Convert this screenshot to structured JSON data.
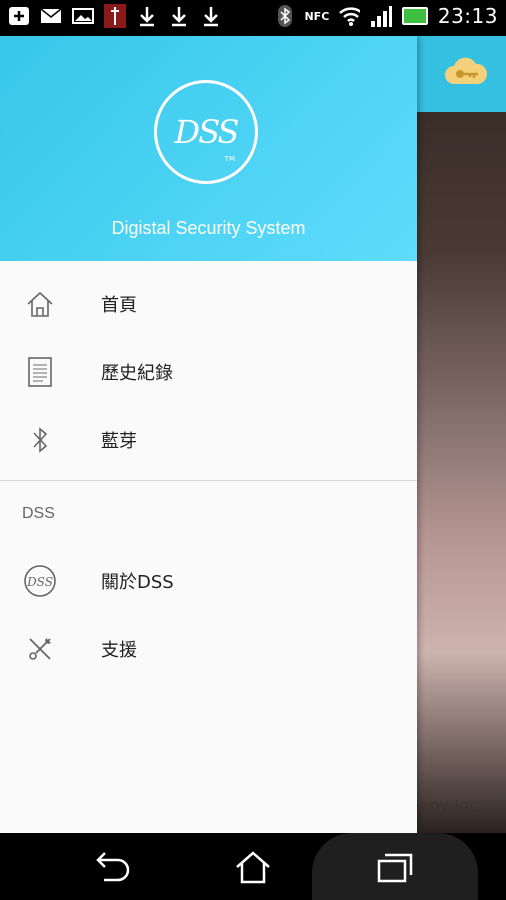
{
  "status_bar": {
    "time": "23:13",
    "nfc_label": "NFC"
  },
  "drawer": {
    "header": {
      "logo_text": "DSS",
      "logo_tm": "TM",
      "title": "Digistal Security System"
    },
    "menu": [
      {
        "label": "首頁",
        "icon": "home-icon"
      },
      {
        "label": "歷史紀錄",
        "icon": "document-icon"
      },
      {
        "label": "藍芽",
        "icon": "bluetooth-icon"
      }
    ],
    "section_label": "DSS",
    "section_menu": [
      {
        "label": "關於DSS",
        "icon": "dss-logo-icon"
      },
      {
        "label": "支援",
        "icon": "tools-icon"
      }
    ]
  },
  "background": {
    "partial_text": "any Inc"
  },
  "colors": {
    "header_start": "#35c7ea",
    "header_end": "#5fdcfb",
    "app_bar": "#35bfe0"
  }
}
